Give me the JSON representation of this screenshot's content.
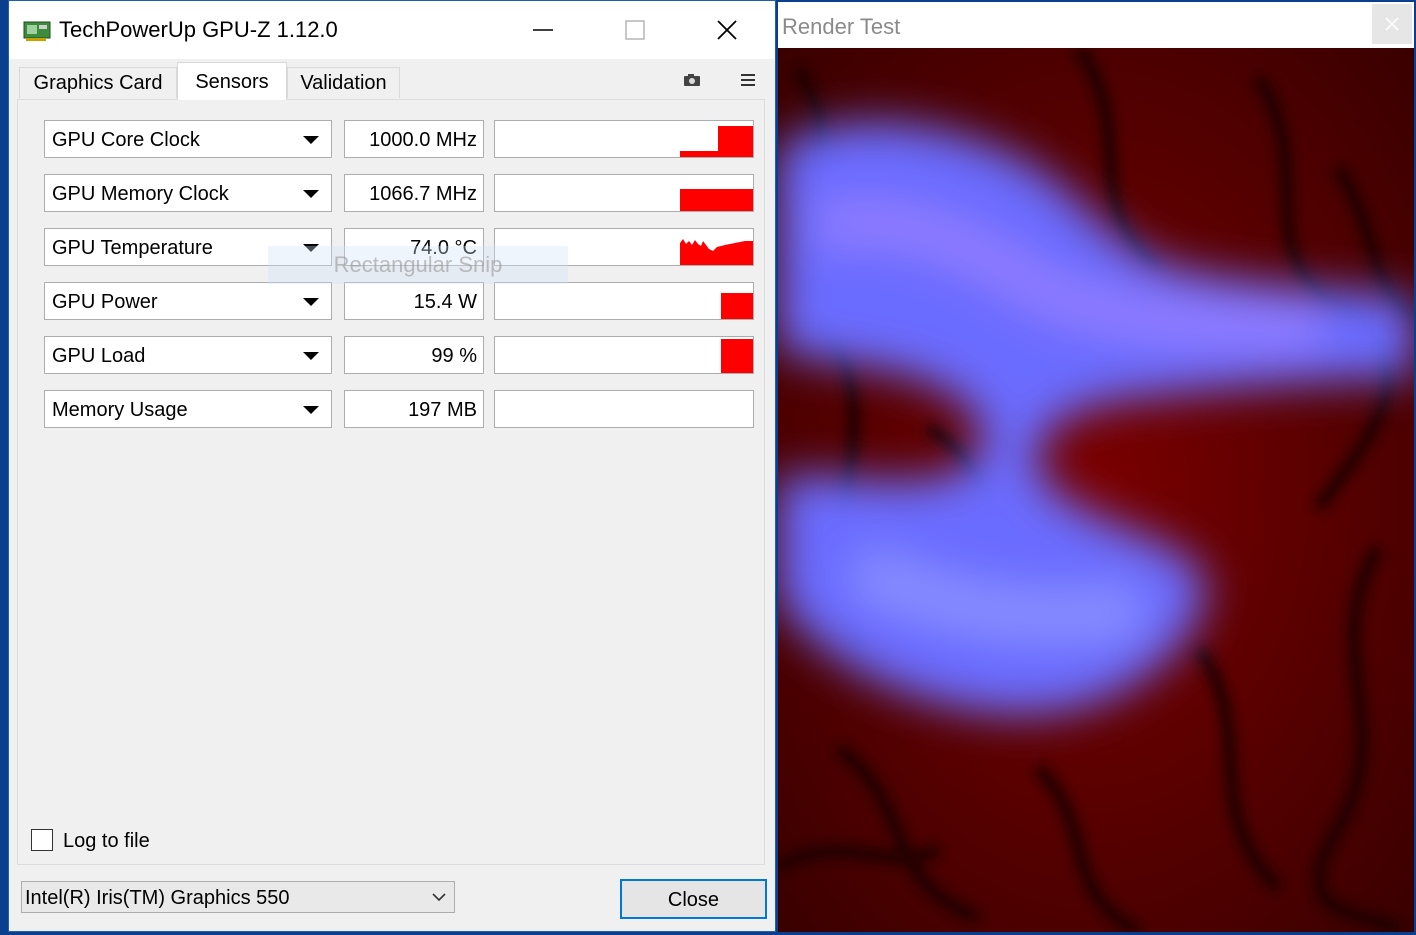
{
  "gpuz": {
    "title": "TechPowerUp GPU-Z 1.12.0",
    "tabs": [
      {
        "label": "Graphics Card"
      },
      {
        "label": "Sensors"
      },
      {
        "label": "Validation"
      }
    ],
    "sensors": [
      {
        "name": "GPU Core Clock",
        "value": "1000.0 MHz"
      },
      {
        "name": "GPU Memory Clock",
        "value": "1066.7 MHz"
      },
      {
        "name": "GPU Temperature",
        "value": "74.0 °C"
      },
      {
        "name": "GPU Power",
        "value": "15.4 W"
      },
      {
        "name": "GPU Load",
        "value": "99 %"
      },
      {
        "name": "Memory Usage",
        "value": "197 MB"
      }
    ],
    "snip_overlay": "Rectangular Snip",
    "log_to_file": {
      "label": "Log to file",
      "checked": false
    },
    "gpu_select": {
      "value": "Intel(R) Iris(TM) Graphics 550"
    },
    "close_label": "Close",
    "graph_color": "#ff0000"
  },
  "render_test": {
    "title": "Render Test"
  }
}
